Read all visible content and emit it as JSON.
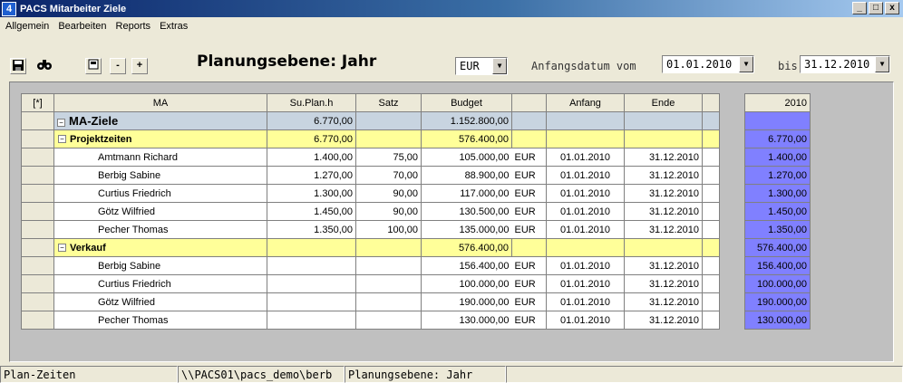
{
  "window": {
    "title": "PACS Mitarbeiter Ziele",
    "app_icon": "4",
    "min": "_",
    "max": "□",
    "close": "x"
  },
  "menu": [
    "Allgemein",
    "Bearbeiten",
    "Reports",
    "Extras"
  ],
  "toolbar": {
    "icons": [
      "save-icon",
      "binoculars-icon",
      "calendar-icon",
      "collapse-icon",
      "expand-icon"
    ],
    "minus": "-",
    "plus": "+",
    "heading": "Planungsebene: Jahr",
    "currency": "EUR",
    "start_label": "Anfangsdatum vom",
    "start_date": "01.01.2010",
    "to_label": "bis",
    "end_date": "31.12.2010"
  },
  "grid": {
    "headers": [
      "[*]",
      "MA",
      "Su.Plan.h",
      "Satz",
      "Budget",
      "",
      "Anfang",
      "Ende",
      ""
    ],
    "group_ma": {
      "label": "MA-Ziele",
      "plan_h": "6.770,00",
      "budget": "1.152.800,00",
      "toggle": "⊟"
    },
    "groups": [
      {
        "label": "Projektzeiten",
        "plan_h": "6.770,00",
        "budget": "576.400,00",
        "rows": [
          {
            "name": "Amtmann Richard",
            "plan_h": "1.400,00",
            "satz": "75,00",
            "budget": "105.000,00",
            "cur": "EUR",
            "start": "01.01.2010",
            "end": "31.12.2010"
          },
          {
            "name": "Berbig Sabine",
            "plan_h": "1.270,00",
            "satz": "70,00",
            "budget": "88.900,00",
            "cur": "EUR",
            "start": "01.01.2010",
            "end": "31.12.2010"
          },
          {
            "name": "Curtius Friedrich",
            "plan_h": "1.300,00",
            "satz": "90,00",
            "budget": "117.000,00",
            "cur": "EUR",
            "start": "01.01.2010",
            "end": "31.12.2010"
          },
          {
            "name": "Götz Wilfried",
            "plan_h": "1.450,00",
            "satz": "90,00",
            "budget": "130.500,00",
            "cur": "EUR",
            "start": "01.01.2010",
            "end": "31.12.2010"
          },
          {
            "name": "Pecher Thomas",
            "plan_h": "1.350,00",
            "satz": "100,00",
            "budget": "135.000,00",
            "cur": "EUR",
            "start": "01.01.2010",
            "end": "31.12.2010"
          }
        ]
      },
      {
        "label": "Verkauf",
        "plan_h": "",
        "budget": "576.400,00",
        "rows": [
          {
            "name": "Berbig Sabine",
            "plan_h": "",
            "satz": "",
            "budget": "156.400,00",
            "cur": "EUR",
            "start": "01.01.2010",
            "end": "31.12.2010"
          },
          {
            "name": "Curtius Friedrich",
            "plan_h": "",
            "satz": "",
            "budget": "100.000,00",
            "cur": "EUR",
            "start": "01.01.2010",
            "end": "31.12.2010"
          },
          {
            "name": "Götz Wilfried",
            "plan_h": "",
            "satz": "",
            "budget": "190.000,00",
            "cur": "EUR",
            "start": "01.01.2010",
            "end": "31.12.2010"
          },
          {
            "name": "Pecher Thomas",
            "plan_h": "",
            "satz": "",
            "budget": "130.000,00",
            "cur": "EUR",
            "start": "01.01.2010",
            "end": "31.12.2010"
          }
        ]
      }
    ]
  },
  "side": {
    "header": "2010",
    "values": [
      "",
      "6.770,00",
      "1.400,00",
      "1.270,00",
      "1.300,00",
      "1.450,00",
      "1.350,00",
      "576.400,00",
      "156.400,00",
      "100.000,00",
      "190.000,00",
      "130.000,00"
    ]
  },
  "status": [
    "Plan-Zeiten",
    "\\\\PACS01\\pacs_demo\\berb",
    "Planungsebene: Jahr"
  ],
  "colors": {
    "ma_row": "#c8d4e0",
    "group_row": "#ffff99",
    "side_cells": "#8080ff"
  }
}
